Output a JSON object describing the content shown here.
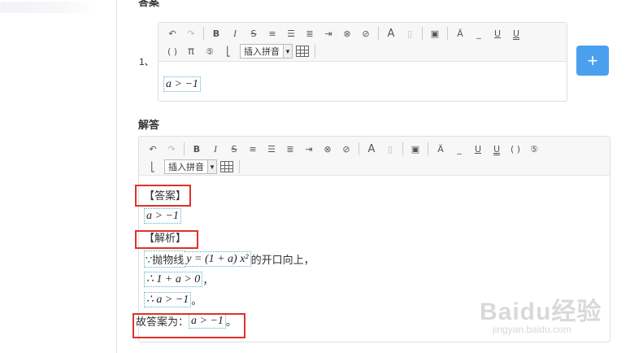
{
  "top_section_title": "答案",
  "answer_index": "1、",
  "answer_value": "a > −1",
  "add_button_label": "+",
  "solution_section_title": "解答",
  "toolbar": {
    "pinyin_select": "插入拼音",
    "paren_label": "( )",
    "pi_label": "π",
    "font_label": "A"
  },
  "solution": {
    "answer_heading": "【答案】",
    "answer_math": "a > −1",
    "analysis_heading": "【解析】",
    "line1_prefix": "∵抛物线",
    "line1_math": "y = (1 + a) x²",
    "line1_suffix": "的开口向上，",
    "line2_math": "∴ 1 + a > 0",
    "line2_suffix": "，",
    "line3_math": "∴ a > −1",
    "line3_suffix": "。",
    "conclusion_prefix": "故答案为：",
    "conclusion_math": "a > −1",
    "conclusion_suffix": "。"
  },
  "watermark": {
    "brand_text": "Baidu经验",
    "url_text": "jingyan.baidu.com"
  },
  "icons": [
    "undo-icon",
    "redo-icon",
    "bold-icon",
    "italic-icon",
    "strikethrough-icon",
    "align-center-icon",
    "align-left-icon",
    "align-right-icon",
    "indent-icon",
    "clear-format-icon",
    "remove-format-icon",
    "font-color-icon",
    "document-icon",
    "image-icon",
    "highlight-icon",
    "underline-blank-icon",
    "underline-icon",
    "double-underline-icon",
    "parentheses-icon",
    "pi-icon",
    "formula-icon",
    "tag-icon",
    "table-icon",
    "plus-icon"
  ],
  "colors": {
    "accent_blue": "#4aa0ef",
    "annotation_red": "#e0312b",
    "math_border": "#5ab0c8"
  }
}
